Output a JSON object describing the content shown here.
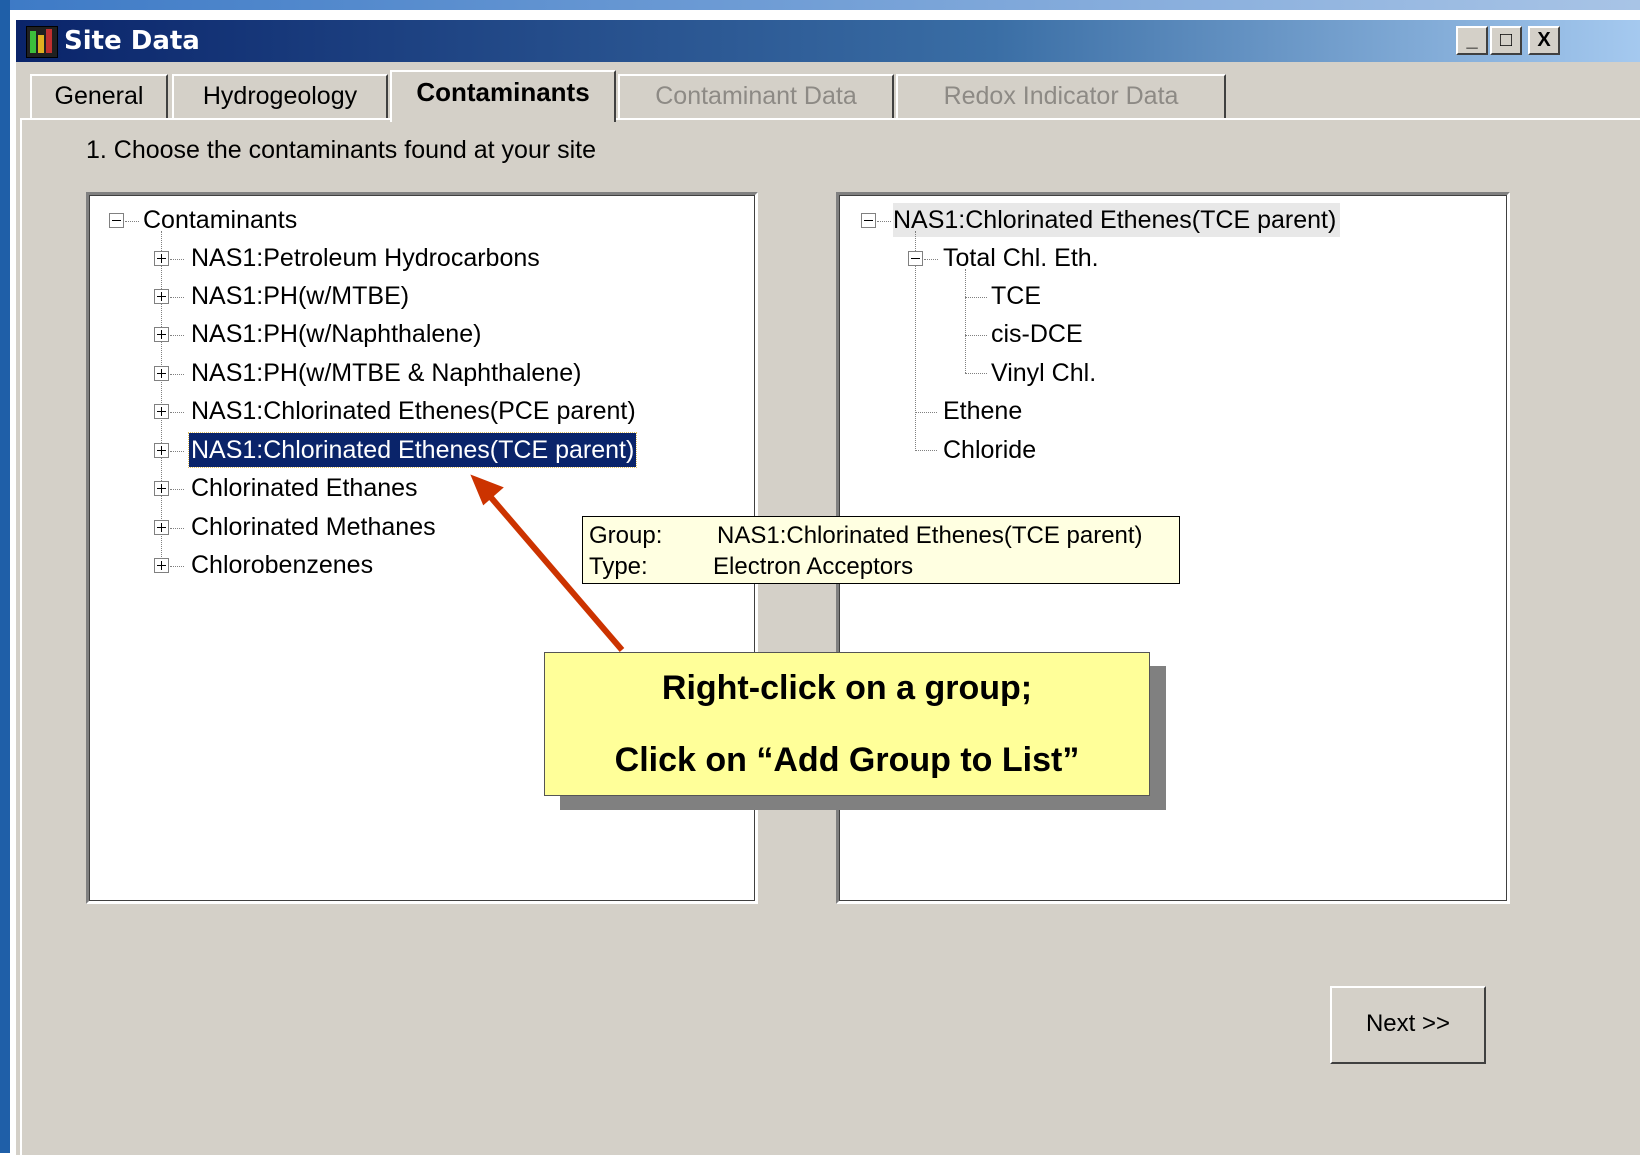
{
  "window": {
    "title": "Site Data",
    "controls": {
      "minimize": "_",
      "maximize": "□",
      "close": "X"
    }
  },
  "tabs": [
    {
      "label": "General",
      "state": "normal"
    },
    {
      "label": "Hydrogeology",
      "state": "normal"
    },
    {
      "label": "Contaminants",
      "state": "active"
    },
    {
      "label": "Contaminant Data",
      "state": "disabled"
    },
    {
      "label": "Redox Indicator Data",
      "state": "disabled"
    }
  ],
  "instruction": "1. Choose the contaminants found at your site",
  "left_tree": {
    "root": "Contaminants",
    "items": [
      "NAS1:Petroleum Hydrocarbons",
      "NAS1:PH(w/MTBE)",
      "NAS1:PH(w/Naphthalene)",
      "NAS1:PH(w/MTBE & Naphthalene)",
      "NAS1:Chlorinated Ethenes(PCE parent)",
      "NAS1:Chlorinated Ethenes(TCE parent)",
      "Chlorinated Ethanes",
      "Chlorinated Methanes",
      "Chlorobenzenes"
    ],
    "selected_index": 5
  },
  "right_tree": {
    "root": "NAS1:Chlorinated Ethenes(TCE parent)",
    "group": "Total Chl. Eth.",
    "group_children": [
      "TCE",
      "cis-DCE",
      "Vinyl Chl."
    ],
    "siblings": [
      "Ethene",
      "Chloride"
    ]
  },
  "tooltip": {
    "group_label": "Group:",
    "group_value": "NAS1:Chlorinated Ethenes(TCE parent)",
    "type_label": "Type:",
    "type_value": "Electron Acceptors"
  },
  "callout": {
    "line1": "Right-click on a group;",
    "line2": "Click on “Add Group to List”"
  },
  "next_button": "Next >>",
  "colors": {
    "selection": "#0a246a",
    "callout_bg": "#ffff99",
    "arrow": "#cc3300",
    "tooltip_bg": "#ffffe1"
  }
}
